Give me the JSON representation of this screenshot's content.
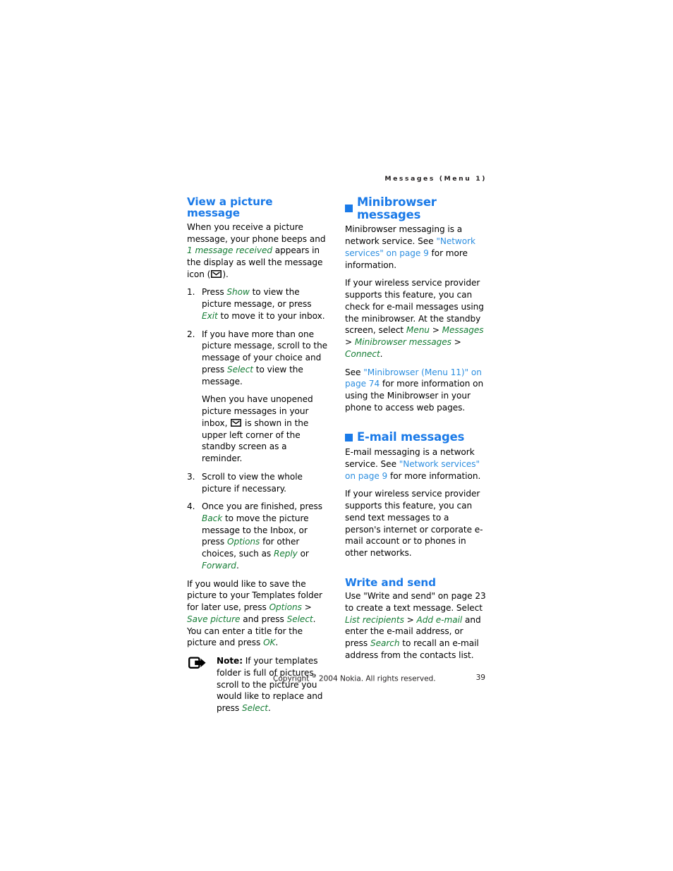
{
  "page": {
    "running_header": "Messages (Menu 1)",
    "page_number": "39",
    "copyright": "Copyright © 2004 Nokia. All rights reserved.",
    "copyright_pre": "Copyright ",
    "copyright_sup": "©",
    "copyright_post": " 2004 Nokia. All rights reserved."
  },
  "colors": {
    "heading_blue": "#1a7ae8",
    "link_blue": "#2e8fe0",
    "green_italic": "#157d35",
    "body_black": "#000000"
  },
  "left_column": {
    "heading": "View a picture message",
    "intro": {
      "part1": "When you receive a picture message, your phone beeps and ",
      "em1": "1 message received",
      "part2": " appears in the display as well the message icon (",
      "part3": ")."
    },
    "steps": [
      {
        "num": "1.",
        "paragraphs": [
          {
            "segments": [
              {
                "t": "Press ",
                "s": "plain"
              },
              {
                "t": "Show",
                "s": "green"
              },
              {
                "t": " to view the picture message, or press ",
                "s": "plain"
              },
              {
                "t": "Exit",
                "s": "green"
              },
              {
                "t": " to move it to your inbox.",
                "s": "plain"
              }
            ]
          }
        ]
      },
      {
        "num": "2.",
        "paragraphs": [
          {
            "segments": [
              {
                "t": "If you have more than one picture message, scroll to the message of your choice and press ",
                "s": "plain"
              },
              {
                "t": "Select",
                "s": "green"
              },
              {
                "t": " to view the message.",
                "s": "plain"
              }
            ]
          },
          {
            "segments": [
              {
                "t": "When you have unopened picture messages in your inbox, ",
                "s": "plain"
              },
              {
                "t": "",
                "s": "envelope-icon"
              },
              {
                "t": " is shown in the upper left corner of the standby screen as a reminder.",
                "s": "plain"
              }
            ]
          }
        ]
      },
      {
        "num": "3.",
        "paragraphs": [
          {
            "segments": [
              {
                "t": "Scroll to view the whole picture if necessary.",
                "s": "plain"
              }
            ]
          }
        ]
      },
      {
        "num": "4.",
        "paragraphs": [
          {
            "segments": [
              {
                "t": "Once you are finished, press ",
                "s": "plain"
              },
              {
                "t": "Back",
                "s": "green"
              },
              {
                "t": " to move the picture message to the Inbox, or press ",
                "s": "plain"
              },
              {
                "t": "Options",
                "s": "green"
              },
              {
                "t": " for other choices, such as ",
                "s": "plain"
              },
              {
                "t": "Reply",
                "s": "green"
              },
              {
                "t": " or ",
                "s": "plain"
              },
              {
                "t": "Forward",
                "s": "green"
              },
              {
                "t": ".",
                "s": "plain"
              }
            ]
          }
        ]
      }
    ],
    "save_paragraph": {
      "p1": "If you would like to save the picture to your Templates folder for later use, press ",
      "em1": "Options",
      "sep1": " > ",
      "em2": "Save picture",
      "p2": " and press ",
      "em3": "Select",
      "p3": ". You can enter a title for the picture and press ",
      "em4": "OK",
      "p4": "."
    },
    "note": {
      "label": "Note:",
      "text_pre": " If your templates folder is full of pictures, scroll to the picture you would like to replace and press ",
      "em": "Select",
      "text_post": "."
    }
  },
  "right_column": {
    "minibrowser": {
      "heading": "Minibrowser messages",
      "p1": {
        "pre": "Minibrowser messaging is a network service. See ",
        "link1": "\"Network services\" on page 9",
        "post": " for more information."
      },
      "p2": {
        "pre": "If your wireless service provider supports this feature, you can check for e-mail messages using the minibrowser. At the standby screen, select ",
        "em1": "Menu",
        "sep1": " > ",
        "em2": "Messages",
        "sep2": " > ",
        "em3": "Minibrowser messages",
        "sep3": " > ",
        "em4": "Connect",
        "post": "."
      },
      "p3": {
        "pre": "See ",
        "link1": "\"Minibrowser (Menu 11)\" on page 74",
        "post": " for more information on using the Minibrowser in your phone to access web pages."
      }
    },
    "email": {
      "heading": "E-mail messages",
      "p1": {
        "pre": "E-mail messaging is a network service. See ",
        "link1": "\"Network services\" on page 9",
        "post": " for more information."
      },
      "p2": "If your wireless service provider supports this feature, you can send text messages to a person's internet or corporate e-mail account or to phones in other networks."
    },
    "write_and_send": {
      "heading": "Write and send",
      "p1": {
        "pre": "Use \"Write and send\" on page 23 to create a text message. Select ",
        "em1": "List recipients",
        "sep1": " > ",
        "em2": "Add e-mail",
        "mid": " and enter the e-mail address, or press ",
        "em3": "Search",
        "post": " to recall an e-mail address from the contacts list."
      }
    }
  }
}
